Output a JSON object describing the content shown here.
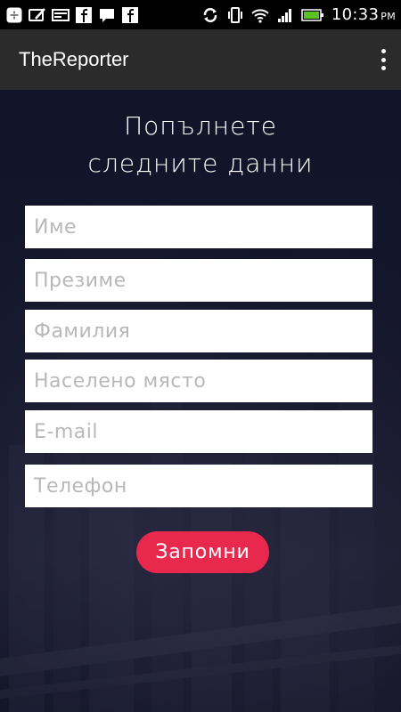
{
  "status_bar": {
    "icons_left": [
      "add-icon",
      "photo-edit-icon",
      "card-icon",
      "facebook-icon",
      "chat-icon",
      "facebook-icon"
    ],
    "icons_right": [
      "sync-icon",
      "vibrate-icon",
      "wifi-icon",
      "signal-icon",
      "battery-icon"
    ],
    "time": "10:33",
    "ampm": "PM"
  },
  "appbar": {
    "title": "TheReporter",
    "menu_icon": "overflow-menu-icon"
  },
  "form": {
    "heading_line1": "Попълнете",
    "heading_line2": "следните данни",
    "fields": [
      {
        "placeholder": "Име",
        "value": ""
      },
      {
        "placeholder": "Презиме",
        "value": ""
      },
      {
        "placeholder": "Фамилия",
        "value": ""
      },
      {
        "placeholder": "Населено място",
        "value": ""
      },
      {
        "placeholder": "E-mail",
        "value": ""
      },
      {
        "placeholder": "Телефон",
        "value": ""
      }
    ],
    "submit_label": "Запомни"
  },
  "colors": {
    "accent": "#e8294d",
    "appbar": "#2b2b2b",
    "background": "#12142a"
  }
}
